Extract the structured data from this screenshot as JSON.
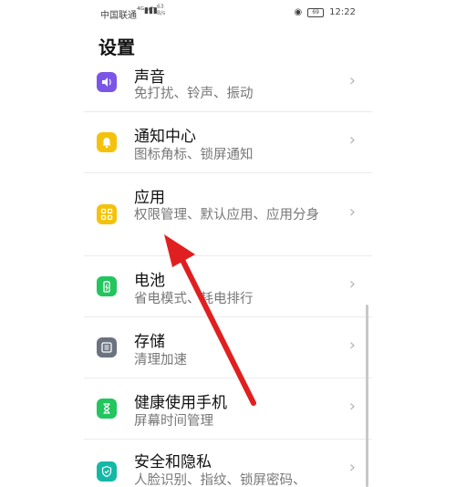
{
  "status_bar": {
    "carrier": "中国联通",
    "net_speed_value": "63",
    "net_speed_unit": "B/s",
    "battery": "69",
    "time": "12:22"
  },
  "page": {
    "title": "设置"
  },
  "settings": [
    {
      "title": "声音",
      "subtitle": "免打扰、铃声、振动",
      "icon": "speaker-icon",
      "color": "#7b56e6"
    },
    {
      "title": "通知中心",
      "subtitle": "图标角标、锁屏通知",
      "icon": "bell-icon",
      "color": "#f4c20d"
    },
    {
      "title": "应用",
      "subtitle": "权限管理、默认应用、应用分身",
      "icon": "apps-grid-icon",
      "color": "#f4c20d"
    },
    {
      "title": "电池",
      "subtitle": "省电模式、耗电排行",
      "icon": "battery-icon",
      "color": "#22c55e"
    },
    {
      "title": "存储",
      "subtitle": "清理加速",
      "icon": "storage-icon",
      "color": "#6b7280"
    },
    {
      "title": "健康使用手机",
      "subtitle": "屏幕时间管理",
      "icon": "hourglass-icon",
      "color": "#22c55e"
    },
    {
      "title": "安全和隐私",
      "subtitle": "人脸识别、指纹、锁屏密码、",
      "icon": "shield-icon",
      "color": "#14b8a6"
    }
  ],
  "annotation": {
    "arrow_color": "#e02020"
  }
}
